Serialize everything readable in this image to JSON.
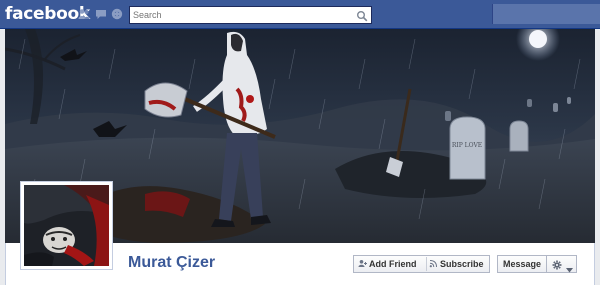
{
  "header": {
    "logo": "facebook",
    "search_placeholder": "Search",
    "icons": [
      "friend-requests-icon",
      "messages-icon",
      "notifications-icon",
      "search-icon"
    ]
  },
  "cover": {
    "tombstone_text": "RIP LOVE"
  },
  "profile": {
    "name": "Murat Çizer"
  },
  "actions": {
    "add_friend": "Add Friend",
    "subscribe": "Subscribe",
    "message": "Message",
    "settings_icon": "gear-icon"
  },
  "colors": {
    "brand_blue": "#3b5998",
    "name_link": "#3b5998",
    "page_bg": "#e9ebee"
  }
}
